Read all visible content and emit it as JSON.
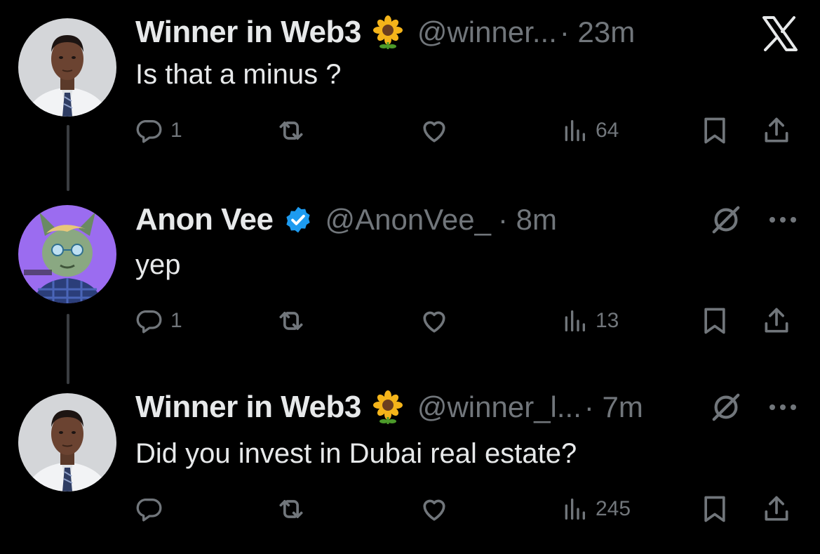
{
  "tweets": [
    {
      "author_name": "Winner in Web3",
      "badge": "sunflower-emoji",
      "handle": "@winner...",
      "time": "· 23m",
      "text": "Is that a minus ?",
      "reply_count": "1",
      "view_count": "64"
    },
    {
      "author_name": "Anon Vee",
      "badge": "verified-badge",
      "handle": "@AnonVee_",
      "time": "· 8m",
      "text": "yep",
      "reply_count": "1",
      "view_count": "13"
    },
    {
      "author_name": "Winner in Web3",
      "badge": "sunflower-emoji",
      "handle": "@winner_l...",
      "time": "· 7m",
      "text": "Did you invest in Dubai real estate?",
      "reply_count": "",
      "view_count": "245"
    }
  ],
  "colors": {
    "background": "#000000",
    "primary_text": "#e7e9ea",
    "secondary_text": "#71767b",
    "verified_blue": "#1d9bf0",
    "avatar_purple": "#9b6cf0"
  },
  "icons": [
    "x-logo-icon",
    "grok-icon",
    "more-icon",
    "reply-icon",
    "repost-icon",
    "like-icon",
    "views-icon",
    "bookmark-icon",
    "share-icon"
  ]
}
